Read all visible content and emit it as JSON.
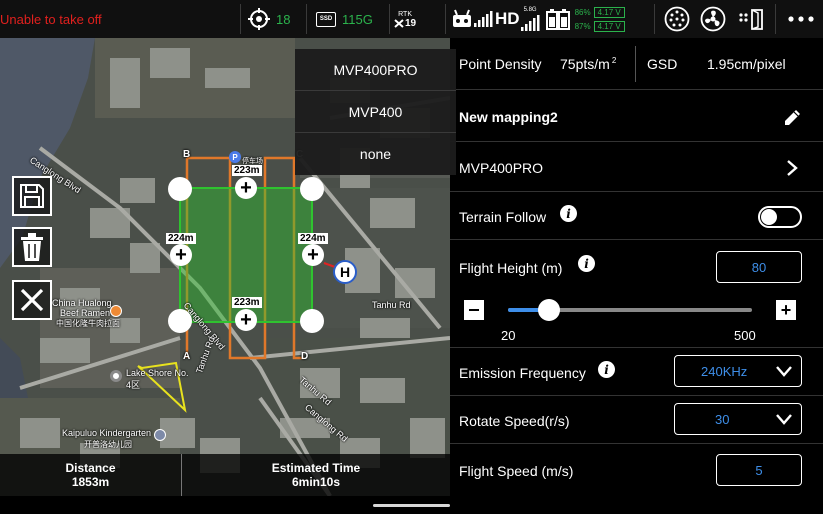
{
  "topbar": {
    "status_text": "Unable to take off",
    "gps_count": "18",
    "ssd_label": "SSD",
    "ssd_value": "115G",
    "rtk_label": "RTK",
    "rtk_count": "19",
    "hd_label": "HD",
    "band_label": "5.8G",
    "battery_1_percent": "86%",
    "battery_1_voltage": "4.17 V",
    "battery_2_percent": "87%",
    "battery_2_voltage": "4.17 V"
  },
  "map": {
    "labels": {
      "canglong_blvd_1": "Canglong Blvd",
      "canglong_blvd_2": "Canglong Blvd",
      "canglong_rd": "Canglong Rd",
      "tanhu_rd_1": "Tanhu Rd",
      "tanhu_rd_2": "Tanhu Rd",
      "tanhu_rd_3": "Tanhu Rd",
      "hualong_1": "China Hualong",
      "hualong_2": "Beef Ramen",
      "hualong_3": "中国化隆牛肉拉面",
      "lake_shore_1": "Lake Shore No.",
      "lake_shore_2": "4区",
      "kindergarten_1": "Kaipuluo Kindergarten",
      "kindergarten_2": "开普洛幼儿园",
      "parking": "停车场"
    },
    "corner_labels": {
      "a": "A",
      "b": "B",
      "c": "C",
      "d": "D"
    },
    "home_label": "H",
    "distances": {
      "top": "223m",
      "middle": "223m",
      "left": "224m",
      "right": "224m"
    },
    "model_menu": [
      "MVP400PRO",
      "MVP400",
      "none"
    ],
    "stats": {
      "distance_label": "Distance",
      "distance_value": "1853m",
      "time_label": "Estimated Time",
      "time_value": "6min10s"
    }
  },
  "panel": {
    "point_density_label": "Point Density",
    "point_density_value": "75pts/m",
    "point_density_exp": "2",
    "gsd_label": "GSD",
    "gsd_value": "1.95cm/pixel",
    "mission_name": "New mapping2",
    "model_value": "MVP400PRO",
    "terrain_follow_label": "Terrain Follow",
    "terrain_follow_on": false,
    "flight_height_label": "Flight Height (m)",
    "flight_height_value": "80",
    "slider_min": "20",
    "slider_max": "500",
    "emission_label": "Emission Frequency",
    "emission_value": "240KHz",
    "rotate_label": "Rotate Speed(r/s)",
    "rotate_value": "30",
    "flight_speed_label": "Flight Speed (m/s)",
    "flight_speed_value": "5"
  },
  "colors": {
    "accent_blue": "#3e8ee8",
    "status_red": "#e0201e",
    "ok_green": "#2bb24c",
    "route_orange": "#e0782a",
    "area_green": "#2fc22f"
  }
}
